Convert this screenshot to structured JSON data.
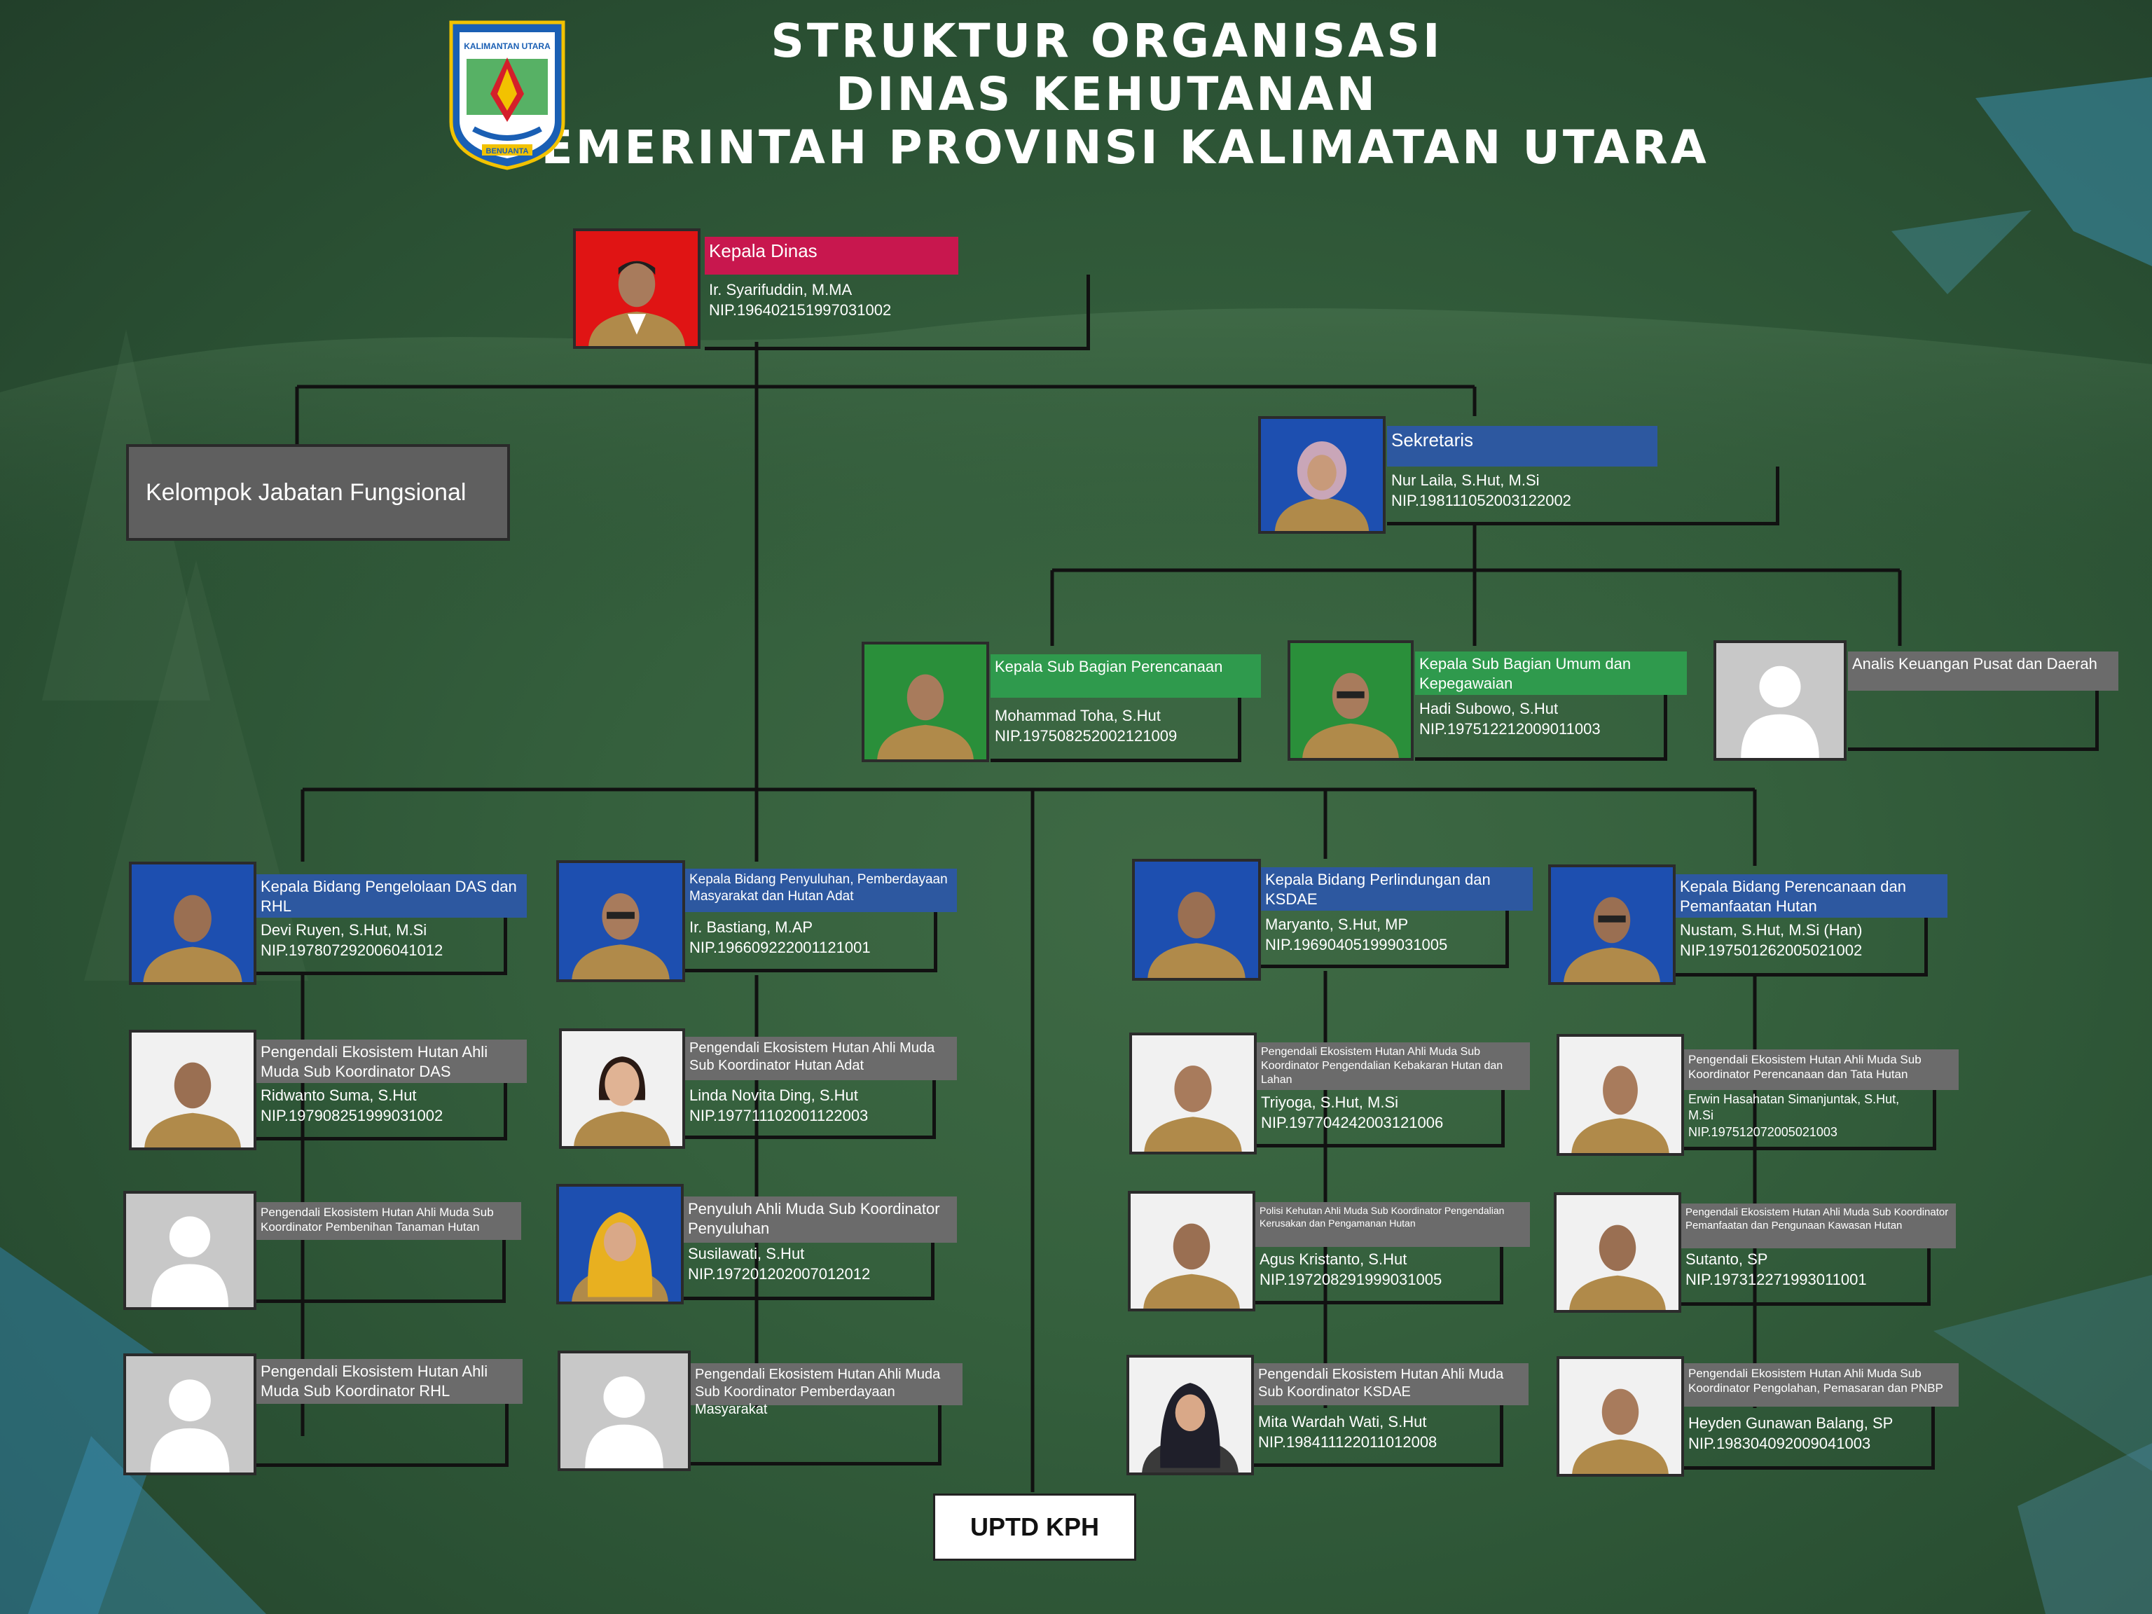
{
  "header": {
    "line1": "STRUKTUR ORGANISASI",
    "line2": "DINAS KEHUTANAN",
    "line3": "PEMERINTAH PROVINSI KALIMATAN UTARA"
  },
  "logo": {
    "top_text": "KALIMANTAN UTARA",
    "bottom_text": "BENUANTA",
    "colors": {
      "border": "#1a5fb4",
      "gold": "#f2c200",
      "red": "#d41f2a"
    }
  },
  "colors": {
    "lines": "#111111",
    "red_label": "#c8174e",
    "blue_label": "#2d58a0",
    "green_label": "#2f9a4d",
    "grey_label": "#6b6b6b"
  },
  "kepala": {
    "role": "Kepala Dinas",
    "name": "Ir. Syarifuddin, M.MA",
    "nip": "NIP.196402151997031002"
  },
  "fungsional": {
    "label": "Kelompok Jabatan Fungsional"
  },
  "sekretaris": {
    "role": "Sekretaris",
    "name": "Nur Laila, S.Hut, M.Si",
    "nip": "NIP.198111052003122002"
  },
  "subbag": [
    {
      "role": "Kepala Sub Bagian Perencanaan",
      "name": "Mohammad Toha, S.Hut",
      "nip": "NIP.197508252002121009"
    },
    {
      "role": "Kepala Sub Bagian Umum dan Kepegawaian",
      "name": "Hadi Subowo, S.Hut",
      "nip": "NIP.197512212009011003"
    },
    {
      "role": "Analis Keuangan Pusat dan Daerah",
      "name": "",
      "nip": ""
    }
  ],
  "bidang": [
    {
      "head": {
        "role": "Kepala Bidang Pengelolaan DAS dan RHL",
        "name": "Devi Ruyen, S.Hut, M.Si",
        "nip": "NIP.197807292006041012"
      },
      "staff": [
        {
          "role": "Pengendali Ekosistem Hutan Ahli Muda Sub Koordinator DAS",
          "name": "Ridwanto Suma, S.Hut",
          "nip": "NIP.197908251999031002"
        },
        {
          "role": "Pengendali Ekosistem Hutan Ahli Muda Sub Koordinator Pembenihan Tanaman Hutan",
          "name": "",
          "nip": ""
        },
        {
          "role": "Pengendali Ekosistem Hutan Ahli Muda Sub Koordinator RHL",
          "name": "",
          "nip": ""
        }
      ]
    },
    {
      "head": {
        "role": "Kepala Bidang Penyuluhan, Pemberdayaan Masyarakat dan Hutan Adat",
        "name": "Ir. Bastiang, M.AP",
        "nip": "NIP.196609222001121001"
      },
      "staff": [
        {
          "role": "Pengendali Ekosistem Hutan Ahli Muda Sub Koordinator Hutan Adat",
          "name": "Linda Novita Ding, S.Hut",
          "nip": "NIP.197711102001122003"
        },
        {
          "role": "Penyuluh Ahli Muda Sub Koordinator  Penyuluhan",
          "name": "Susilawati, S.Hut",
          "nip": "NIP.197201202007012012"
        },
        {
          "role": "Pengendali Ekosistem Hutan Ahli Muda Sub Koordinator Pemberdayaan Masyarakat",
          "name": "",
          "nip": ""
        }
      ]
    },
    {
      "head": {
        "role": "Kepala Bidang Perlindungan dan KSDAE",
        "name": "Maryanto, S.Hut, MP",
        "nip": "NIP.196904051999031005"
      },
      "staff": [
        {
          "role": "Pengendali Ekosistem Hutan Ahli Muda Sub Koordinator Pengendalian Kebakaran Hutan dan Lahan",
          "name": "Triyoga, S.Hut, M.Si",
          "nip": "NIP.197704242003121006"
        },
        {
          "role": "Polisi Kehutan Ahli Muda Sub Koordinator Pengendalian Kerusakan dan Pengamanan Hutan",
          "name": "Agus Kristanto, S.Hut",
          "nip": "NIP.197208291999031005"
        },
        {
          "role": "Pengendali Ekosistem Hutan Ahli Muda Sub Koordinator KSDAE",
          "name": "Mita Wardah Wati, S.Hut",
          "nip": "NIP.198411122011012008"
        }
      ]
    },
    {
      "head": {
        "role": "Kepala Bidang Perencanaan dan Pemanfaatan Hutan",
        "name": "Nustam, S.Hut, M.Si (Han)",
        "nip": "NIP.197501262005021002"
      },
      "staff": [
        {
          "role": "Pengendali Ekosistem Hutan Ahli Muda Sub Koordinator Perencanaan dan Tata Hutan",
          "name": "Erwin Hasahatan Simanjuntak, S.Hut, M.Si",
          "nip": "NIP.197512072005021003"
        },
        {
          "role": "Pengendali Ekosistem Hutan Ahli Muda Sub Koordinator Pemanfaatan dan Pengunaan Kawasan Hutan",
          "name": "Sutanto, SP",
          "nip": "NIP.197312271993011001"
        },
        {
          "role": "Pengendali Ekosistem Hutan Ahli Muda Sub Koordinator Pengolahan, Pemasaran dan PNBP",
          "name": "Heyden Gunawan Balang, SP",
          "nip": "NIP.198304092009041003"
        }
      ]
    }
  ],
  "uptd": {
    "label": "UPTD KPH"
  }
}
